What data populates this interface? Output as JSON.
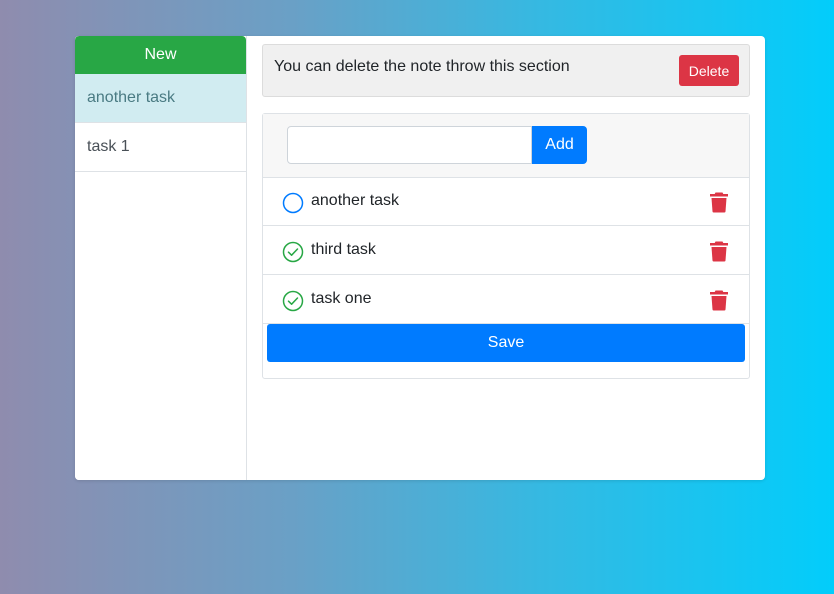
{
  "sidebar": {
    "new_label": "New",
    "notes": [
      {
        "label": "another task",
        "active": true
      },
      {
        "label": "task 1",
        "active": false
      }
    ]
  },
  "alert": {
    "text": "You can delete the note throw this section",
    "delete_label": "Delete"
  },
  "task_form": {
    "input_value": "",
    "input_placeholder": "",
    "add_label": "Add"
  },
  "tasks": [
    {
      "label": "another task",
      "done": false
    },
    {
      "label": "third task",
      "done": true
    },
    {
      "label": "task one",
      "done": true
    }
  ],
  "save_label": "Save",
  "colors": {
    "new_button": "#28a745",
    "active_note_bg": "#d1ecf1",
    "primary": "#007bff",
    "danger": "#dc3545",
    "check_done": "#28a745",
    "check_pending": "#007bff"
  },
  "icons": {
    "task_pending": "circle-icon",
    "task_done": "check-circle-icon",
    "delete_task": "trash-icon"
  }
}
